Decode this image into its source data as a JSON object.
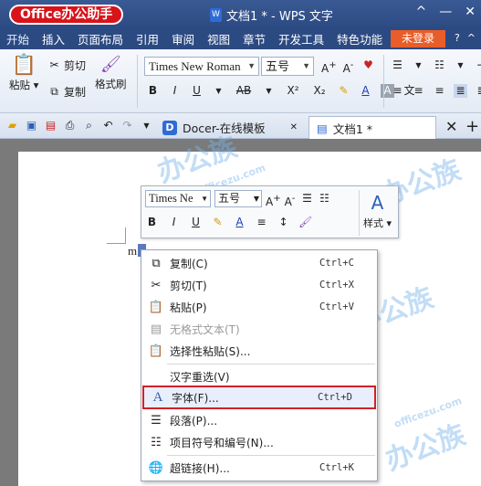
{
  "title_bar": {
    "badge": "Office办公助手",
    "document_title": "文档1 * - WPS 文字"
  },
  "menu": {
    "items": [
      "开始",
      "插入",
      "页面布局",
      "引用",
      "审阅",
      "视图",
      "章节",
      "开发工具",
      "特色功能"
    ],
    "login": "未登录"
  },
  "ribbon": {
    "paste": "粘贴",
    "cut": "剪切",
    "copy": "复制",
    "format_painter": "格式刷",
    "font_name": "Times New Roman",
    "font_size": "五号",
    "bold": "B",
    "italic": "I",
    "underline": "U",
    "strikethrough": "AB",
    "superscript": "X²",
    "subscript": "X₂"
  },
  "tabs": {
    "docer": "Docer-在线模板",
    "document": "文档1 *"
  },
  "document": {
    "text": "m"
  },
  "mini_toolbar": {
    "font_name": "Times Ne",
    "font_size": "五号",
    "styles": "样式",
    "bold": "B",
    "italic": "I",
    "underline": "U"
  },
  "context_menu": [
    {
      "label": "复制(C)",
      "shortcut": "Ctrl+C"
    },
    {
      "label": "剪切(T)",
      "shortcut": "Ctrl+X"
    },
    {
      "label": "粘贴(P)",
      "shortcut": "Ctrl+V"
    },
    {
      "label": "无格式文本(T)",
      "shortcut": ""
    },
    {
      "label": "选择性粘贴(S)...",
      "shortcut": ""
    },
    {
      "label": "汉字重选(V)",
      "shortcut": ""
    },
    {
      "label": "字体(F)...",
      "shortcut": "Ctrl+D"
    },
    {
      "label": "段落(P)...",
      "shortcut": ""
    },
    {
      "label": "项目符号和编号(N)...",
      "shortcut": ""
    },
    {
      "label": "超链接(H)...",
      "shortcut": "Ctrl+K"
    }
  ],
  "watermark": {
    "cn": "办公族",
    "url": "officezu.com"
  },
  "colors": {
    "highlight_border": "#d1202a",
    "login": "#e85d2a",
    "title_bar": "#2c4a82"
  }
}
